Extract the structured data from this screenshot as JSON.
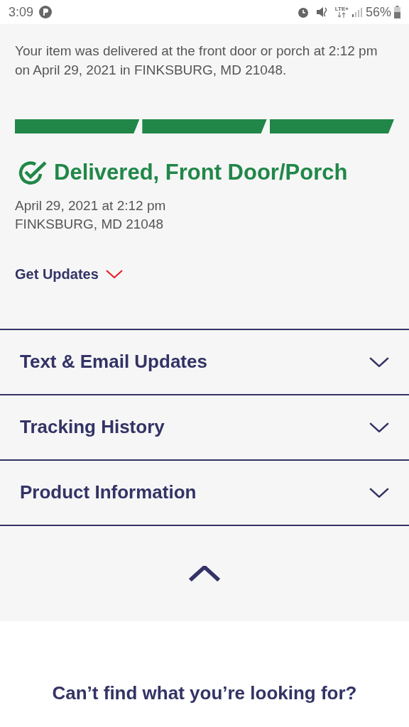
{
  "status_bar": {
    "time": "3:09",
    "network": "LTE+",
    "battery": "56%"
  },
  "message": "Your item was delivered at the front door or porch at 2:12 pm on April 29, 2021 in FINKSBURG, MD 21048.",
  "progress": [
    {
      "filled": true
    },
    {
      "filled": true
    },
    {
      "filled": true
    }
  ],
  "status": {
    "title": "Delivered, Front Door/Porch",
    "date": "April 29, 2021 at 2:12 pm",
    "location": "FINKSBURG, MD 21048"
  },
  "get_updates": {
    "label": "Get Updates",
    "expanded": false
  },
  "sections": [
    {
      "label": "Text & Email Updates",
      "expanded": false
    },
    {
      "label": "Tracking History",
      "expanded": false
    },
    {
      "label": "Product Information",
      "expanded": false
    }
  ],
  "footer": {
    "heading": "Can’t find what you’re looking for?"
  }
}
